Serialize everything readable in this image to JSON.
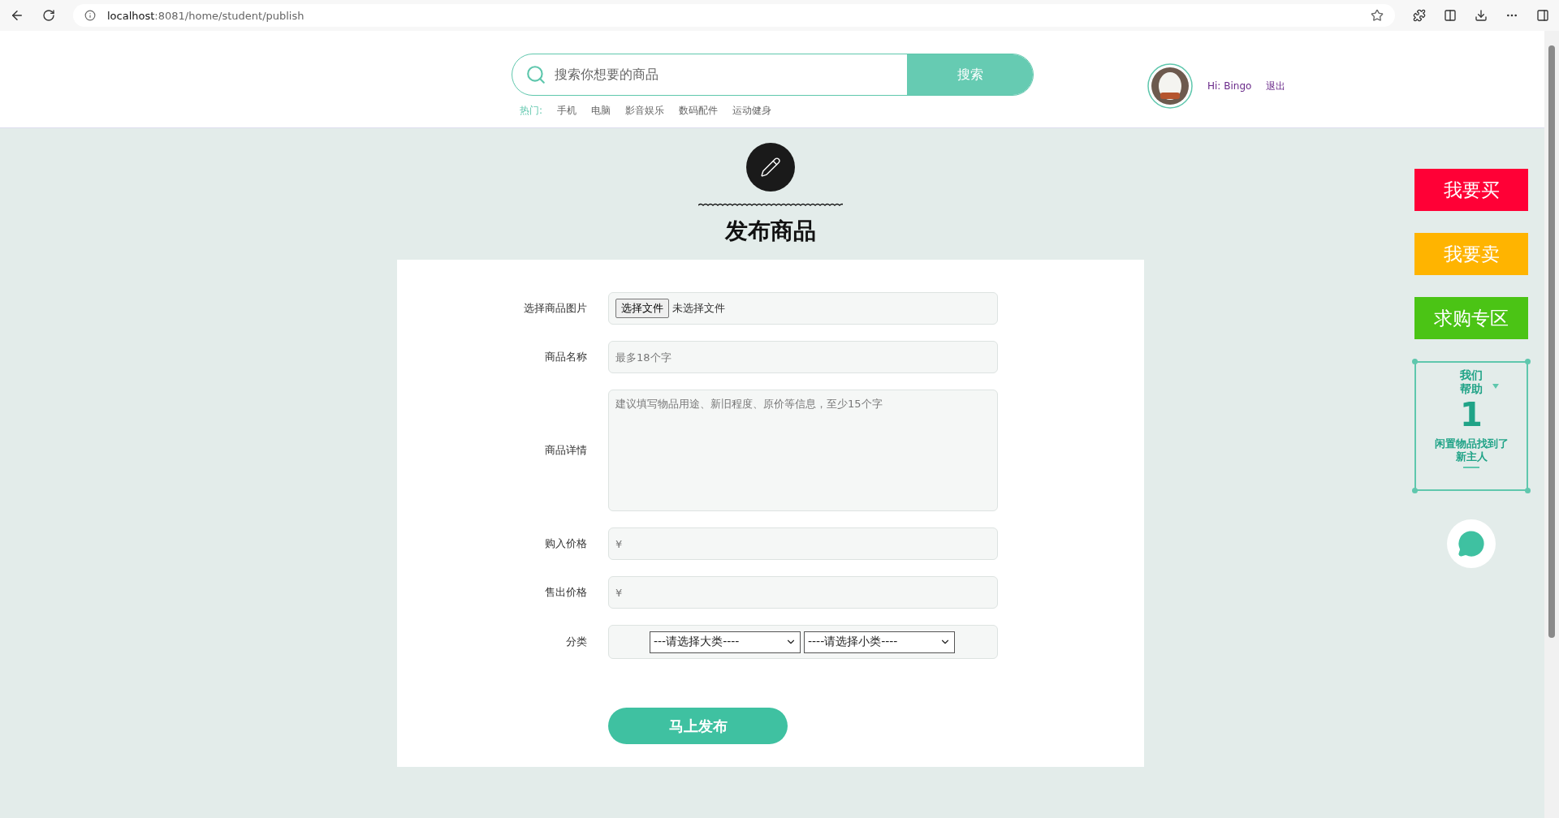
{
  "browser": {
    "url_host": "localhost",
    "url_rest": ":8081/home/student/publish"
  },
  "header": {
    "search_placeholder": "搜索你想要的商品",
    "search_button": "搜索",
    "hot_label": "热门:",
    "hot_tags": [
      "手机",
      "电脑",
      "影音娱乐",
      "数码配件",
      "运动健身"
    ],
    "greeting": "Hi: Bingo",
    "logout": "退出"
  },
  "page_title": "发布商品",
  "form": {
    "fields": [
      {
        "kind": "file",
        "label": "选择商品图片",
        "button": "选择文件",
        "status": "未选择文件"
      },
      {
        "kind": "text",
        "label": "商品名称",
        "placeholder": "最多18个字"
      },
      {
        "kind": "textarea",
        "label": "商品详情",
        "placeholder": "建议填写物品用途、新旧程度、原价等信息，至少15个字"
      },
      {
        "kind": "text",
        "label": "购入价格",
        "placeholder": "¥"
      },
      {
        "kind": "text",
        "label": "售出价格",
        "placeholder": "¥"
      },
      {
        "kind": "selects",
        "label": "分类",
        "options": [
          "---请选择大类----",
          "----请选择小类----"
        ]
      }
    ],
    "submit": "马上发布"
  },
  "sidebar": {
    "buttons": [
      {
        "label": "我要买",
        "color": "#ff0036"
      },
      {
        "label": "我要卖",
        "color": "#ffb400"
      },
      {
        "label": "求购专区",
        "color": "#4bc415"
      }
    ],
    "help": {
      "top": [
        "我们",
        "帮助"
      ],
      "count": "1",
      "bottom": [
        "闲置物品找到了",
        "新主人"
      ]
    }
  }
}
